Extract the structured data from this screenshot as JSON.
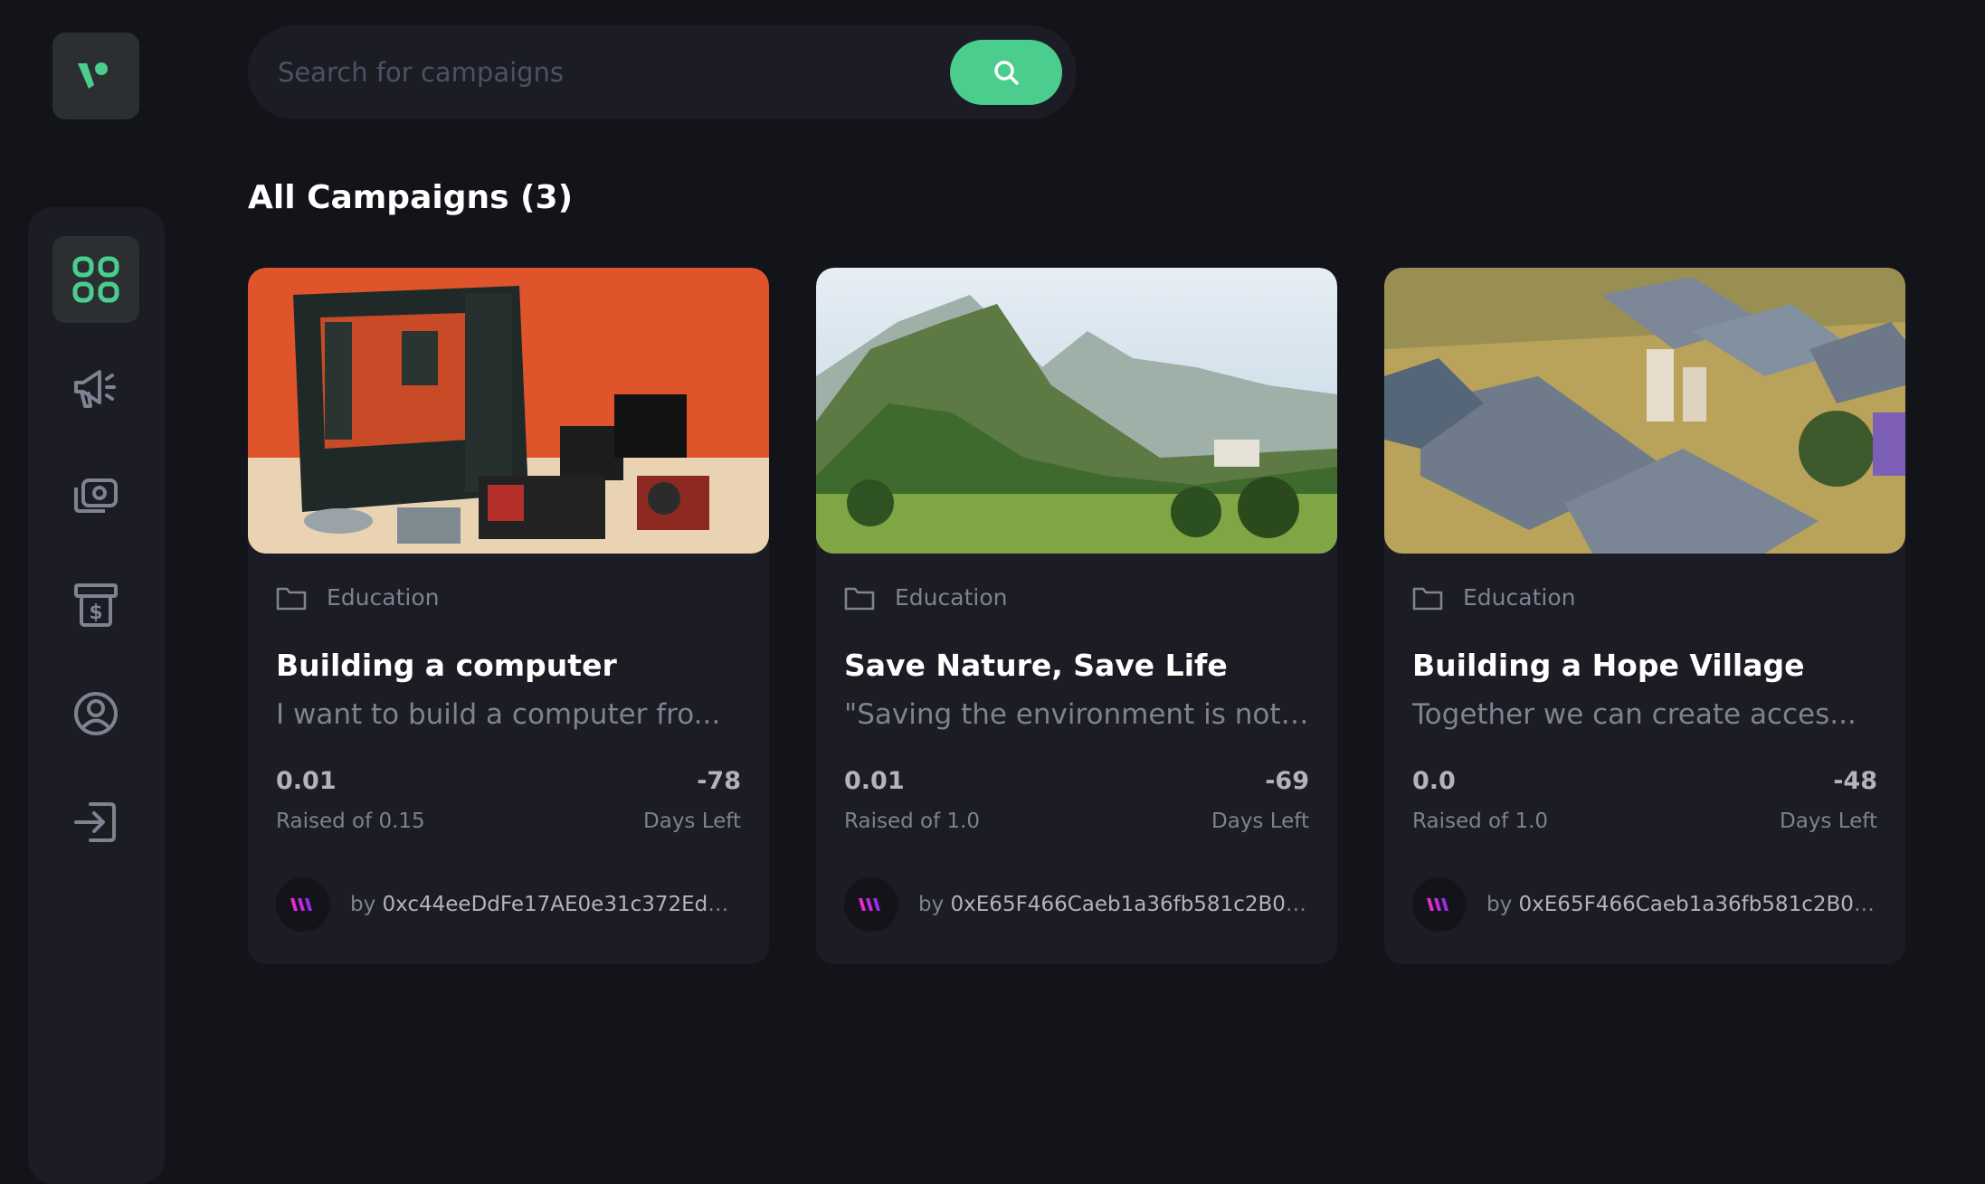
{
  "app": {
    "logo_icon": "brand-logo-icon",
    "accent": "#4acd8d"
  },
  "sidebar": {
    "items": [
      {
        "icon": "dashboard-grid-icon",
        "active": true
      },
      {
        "icon": "megaphone-icon",
        "active": false
      },
      {
        "icon": "payment-camera-icon",
        "active": false
      },
      {
        "icon": "withdraw-dollar-icon",
        "active": false
      },
      {
        "icon": "profile-icon",
        "active": false
      },
      {
        "icon": "logout-icon",
        "active": false
      }
    ]
  },
  "search": {
    "placeholder": "Search for campaigns",
    "value": "",
    "button_icon": "search-icon"
  },
  "main": {
    "title": "All Campaigns (3)"
  },
  "campaigns": [
    {
      "image": "computer-parts-photo",
      "category": "Education",
      "title": "Building a computer",
      "description": "I want to build a computer fro...",
      "raised": "0.01",
      "raised_label": "Raised of 0.15",
      "days": "-78",
      "days_label": "Days Left",
      "by": "by",
      "owner": "0xc44eeDdFe17AE0e31c372EdBC..."
    },
    {
      "image": "mountain-valley-photo",
      "category": "Education",
      "title": "Save Nature, Save Life",
      "description": "\"Saving the environment is not ...",
      "raised": "0.01",
      "raised_label": "Raised of 1.0",
      "days": "-69",
      "days_label": "Days Left",
      "by": "by",
      "owner": "0xE65F466Caeb1a36fb581c2B05..."
    },
    {
      "image": "village-aerial-photo",
      "category": "Education",
      "title": "Building a Hope Village",
      "description": "Together we can create acces...",
      "raised": "0.0",
      "raised_label": "Raised of 1.0",
      "days": "-48",
      "days_label": "Days Left",
      "by": "by",
      "owner": "0xE65F466Caeb1a36fb581c2B05..."
    }
  ]
}
